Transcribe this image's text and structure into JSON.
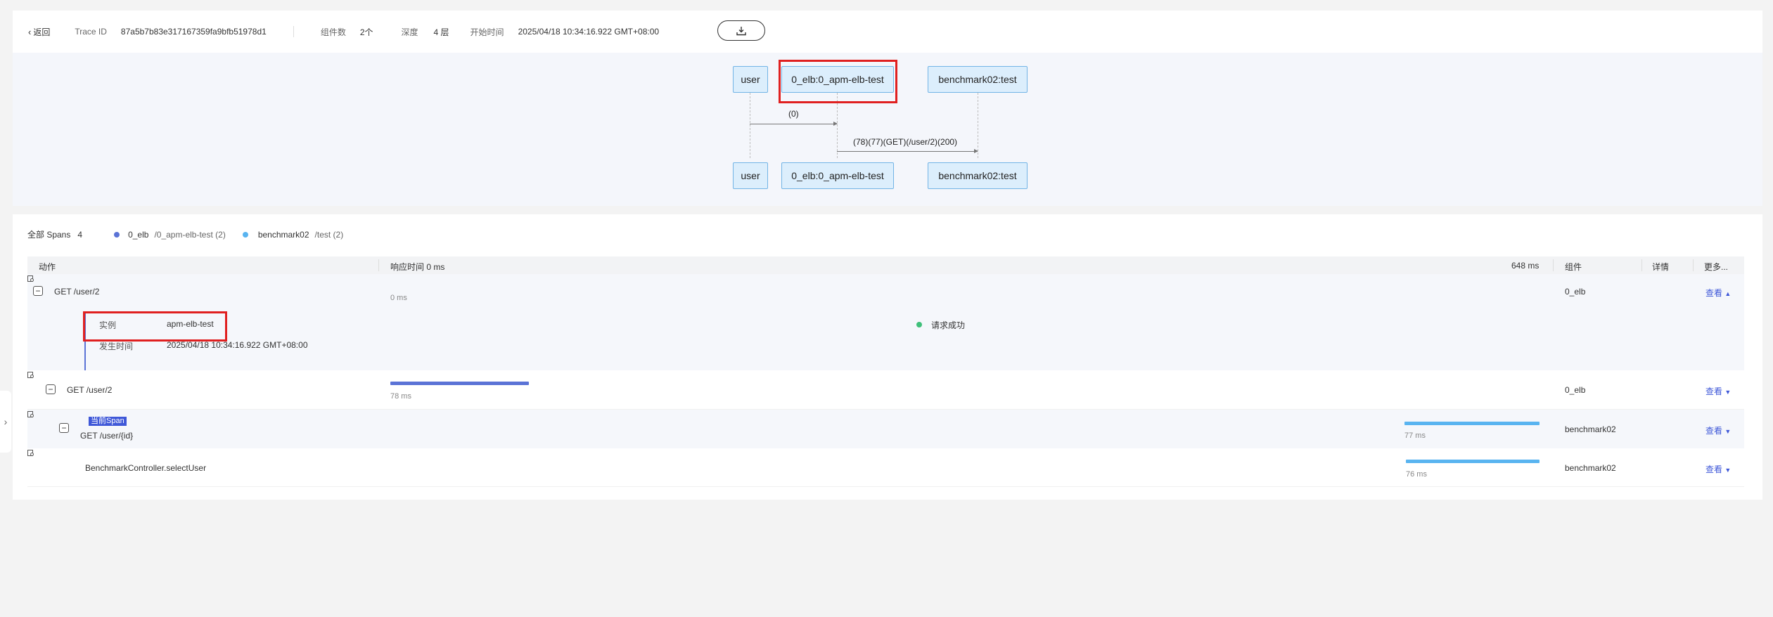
{
  "header": {
    "back_label": "返回",
    "trace_id_label": "Trace ID",
    "trace_id": "87a5b7b83e317167359fa9bfb51978d1",
    "component_count_label": "组件数",
    "component_count": "2个",
    "depth_label": "深度",
    "depth": "4 层",
    "start_time_label": "开始时间",
    "start_time": "2025/04/18 10:34:16.922 GMT+08:00",
    "download_icon": "download-icon"
  },
  "topology": {
    "nodes": [
      "user",
      "0_elb:0_apm-elb-test",
      "benchmark02:test"
    ],
    "messages": [
      "(0)",
      "(78)(77)(GET)(/user/2)(200)"
    ]
  },
  "spans": {
    "all_label": "全部 Spans",
    "all_count": "4",
    "legend": [
      {
        "name": "0_elb",
        "sub": "/0_apm-elb-test (2)",
        "color": "#5b73d6"
      },
      {
        "name": "benchmark02",
        "sub": "/test (2)",
        "color": "#59b4f0"
      }
    ],
    "columns": {
      "action": "动作",
      "response_time": "响应时间 0 ms",
      "max_time": "648 ms",
      "component": "组件",
      "detail": "详情",
      "more": "更多..."
    },
    "rows": [
      {
        "action": "GET /user/2",
        "time": "0 ms",
        "component": "0_elb",
        "more": "查看",
        "fraction": 0.0
      },
      {
        "action": "GET /user/2",
        "time": "78 ms",
        "component": "0_elb",
        "more": "查看",
        "fraction": 0.12
      },
      {
        "badge": "当前Span",
        "action": "GET /user/{id}",
        "time": "77 ms",
        "component": "benchmark02",
        "more": "查看",
        "fraction": 0.119
      },
      {
        "action": "BenchmarkController.selectUser",
        "time": "76 ms",
        "component": "benchmark02",
        "more": "查看",
        "fraction": 0.117
      }
    ],
    "expanded": {
      "instance_label": "实例",
      "instance_value": "apm-elb-test",
      "time_label": "发生时间",
      "time_value": "2025/04/18 10:34:16.922 GMT+08:00",
      "status": "请求成功",
      "status_color": "#3fc07a"
    },
    "bar_colors": {
      "elb": "#5b73d6",
      "benchmark": "#59b4f0"
    }
  }
}
